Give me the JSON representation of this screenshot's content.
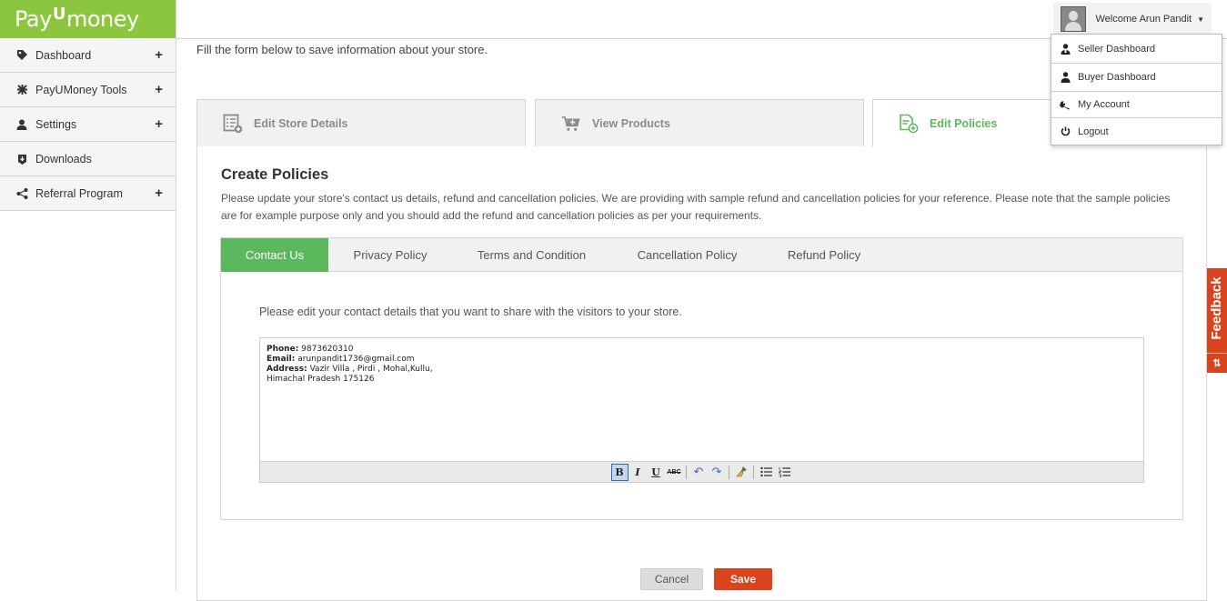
{
  "brand": {
    "logo_left": "Pay",
    "logo_u": "U",
    "logo_right": "money"
  },
  "sidebar": {
    "items": [
      {
        "label": "Dashboard",
        "icon": "tag-icon",
        "expandable": true
      },
      {
        "label": "PayUMoney Tools",
        "icon": "tools-icon",
        "expandable": true
      },
      {
        "label": "Settings",
        "icon": "user-icon",
        "expandable": true
      },
      {
        "label": "Downloads",
        "icon": "download-icon",
        "expandable": false
      },
      {
        "label": "Referral Program",
        "icon": "share-icon",
        "expandable": true
      }
    ],
    "plus": "+"
  },
  "header": {
    "welcome": "Welcome Arun Pandit",
    "caret": "▼"
  },
  "user_menu": {
    "items": [
      {
        "label": "Seller Dashboard",
        "icon": "seller-icon"
      },
      {
        "label": "Buyer Dashboard",
        "icon": "buyer-icon"
      },
      {
        "label": "My Account",
        "icon": "wrench-icon"
      },
      {
        "label": "Logout",
        "icon": "power-icon"
      }
    ]
  },
  "main": {
    "intro": "Fill the form below to save information about your store.",
    "steps": [
      {
        "label": "Edit Store Details",
        "active": false
      },
      {
        "label": "View Products",
        "active": false
      },
      {
        "label": "Edit Policies",
        "active": true
      }
    ],
    "create_title": "Create Policies",
    "create_desc": "Please update your store's contact us details, refund and cancellation policies. We are providing with sample refund and cancellation policies for your reference. Please note that the sample policies are for example purpose only and you should add the refund and cancellation policies as per your requirements.",
    "policy_tabs": [
      "Contact Us",
      "Privacy Policy",
      "Terms and Condition",
      "Cancellation Policy",
      "Refund Policy"
    ],
    "active_policy_tab": "Contact Us",
    "contact_note": "Please edit your contact details that you want to share with the visitors to your store.",
    "editor": {
      "phone_label": "Phone:",
      "phone": "9873620310",
      "email_label": "Email:",
      "email": "arunpandit1736@gmail.com",
      "address_label": "Address:",
      "address_line1": "Vazir Villa , Pirdi , Mohal,Kullu,",
      "address_line2": "Himachal Pradesh 175126"
    },
    "toolbar": {
      "bold": "B",
      "italic": "I",
      "underline": "U",
      "strike": "ABC",
      "undo": "↶",
      "redo": "↷",
      "clean": "🧹",
      "ul": "☰",
      "ol": "☷"
    },
    "cancel_label": "Cancel",
    "save_label": "Save"
  },
  "feedback": {
    "label": "Feedback",
    "icon_glyph": "⇅"
  },
  "colors": {
    "brand_green": "#8cc63f",
    "active_green": "#5cb85c",
    "save_orange": "#d9431e"
  }
}
